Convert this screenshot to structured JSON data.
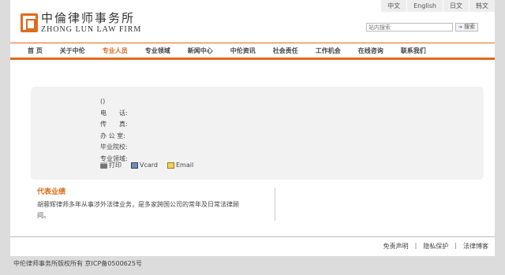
{
  "header": {
    "logo_cn": "中倫律师事务所",
    "logo_en": "ZHONG LUN LAW FIRM",
    "languages": [
      "中文",
      "English",
      "日文",
      "韩文"
    ],
    "search_placeholder": "站内搜索",
    "search_button": "搜索"
  },
  "nav": {
    "items": [
      "首 页",
      "关于中伦",
      "专业人员",
      "专业领域",
      "新闻中心",
      "中伦资讯",
      "社会责任",
      "工作机会",
      "在线咨询",
      "联系我们"
    ],
    "active_index": 2
  },
  "profile": {
    "name_line": "()",
    "phone_label": "电　　话:",
    "fax_label": "传　　真:",
    "office_label": "办 公 室:",
    "school_label": "毕业院校:",
    "field_label": "专业领域:",
    "print_label": "打印",
    "vcard_label": "Vcard",
    "email_label": "Email"
  },
  "works": {
    "title": "代表业绩",
    "text": "胡蓉辉律师多年从事涉外法律业务，是多家跨国公司的常年及日常法律顾问。"
  },
  "footer": {
    "links": [
      "免责声明",
      "隐私保护",
      "法律博客"
    ],
    "separator": "|",
    "copyright": "中伦律师事务所版权所有 京ICP备0500625号"
  }
}
